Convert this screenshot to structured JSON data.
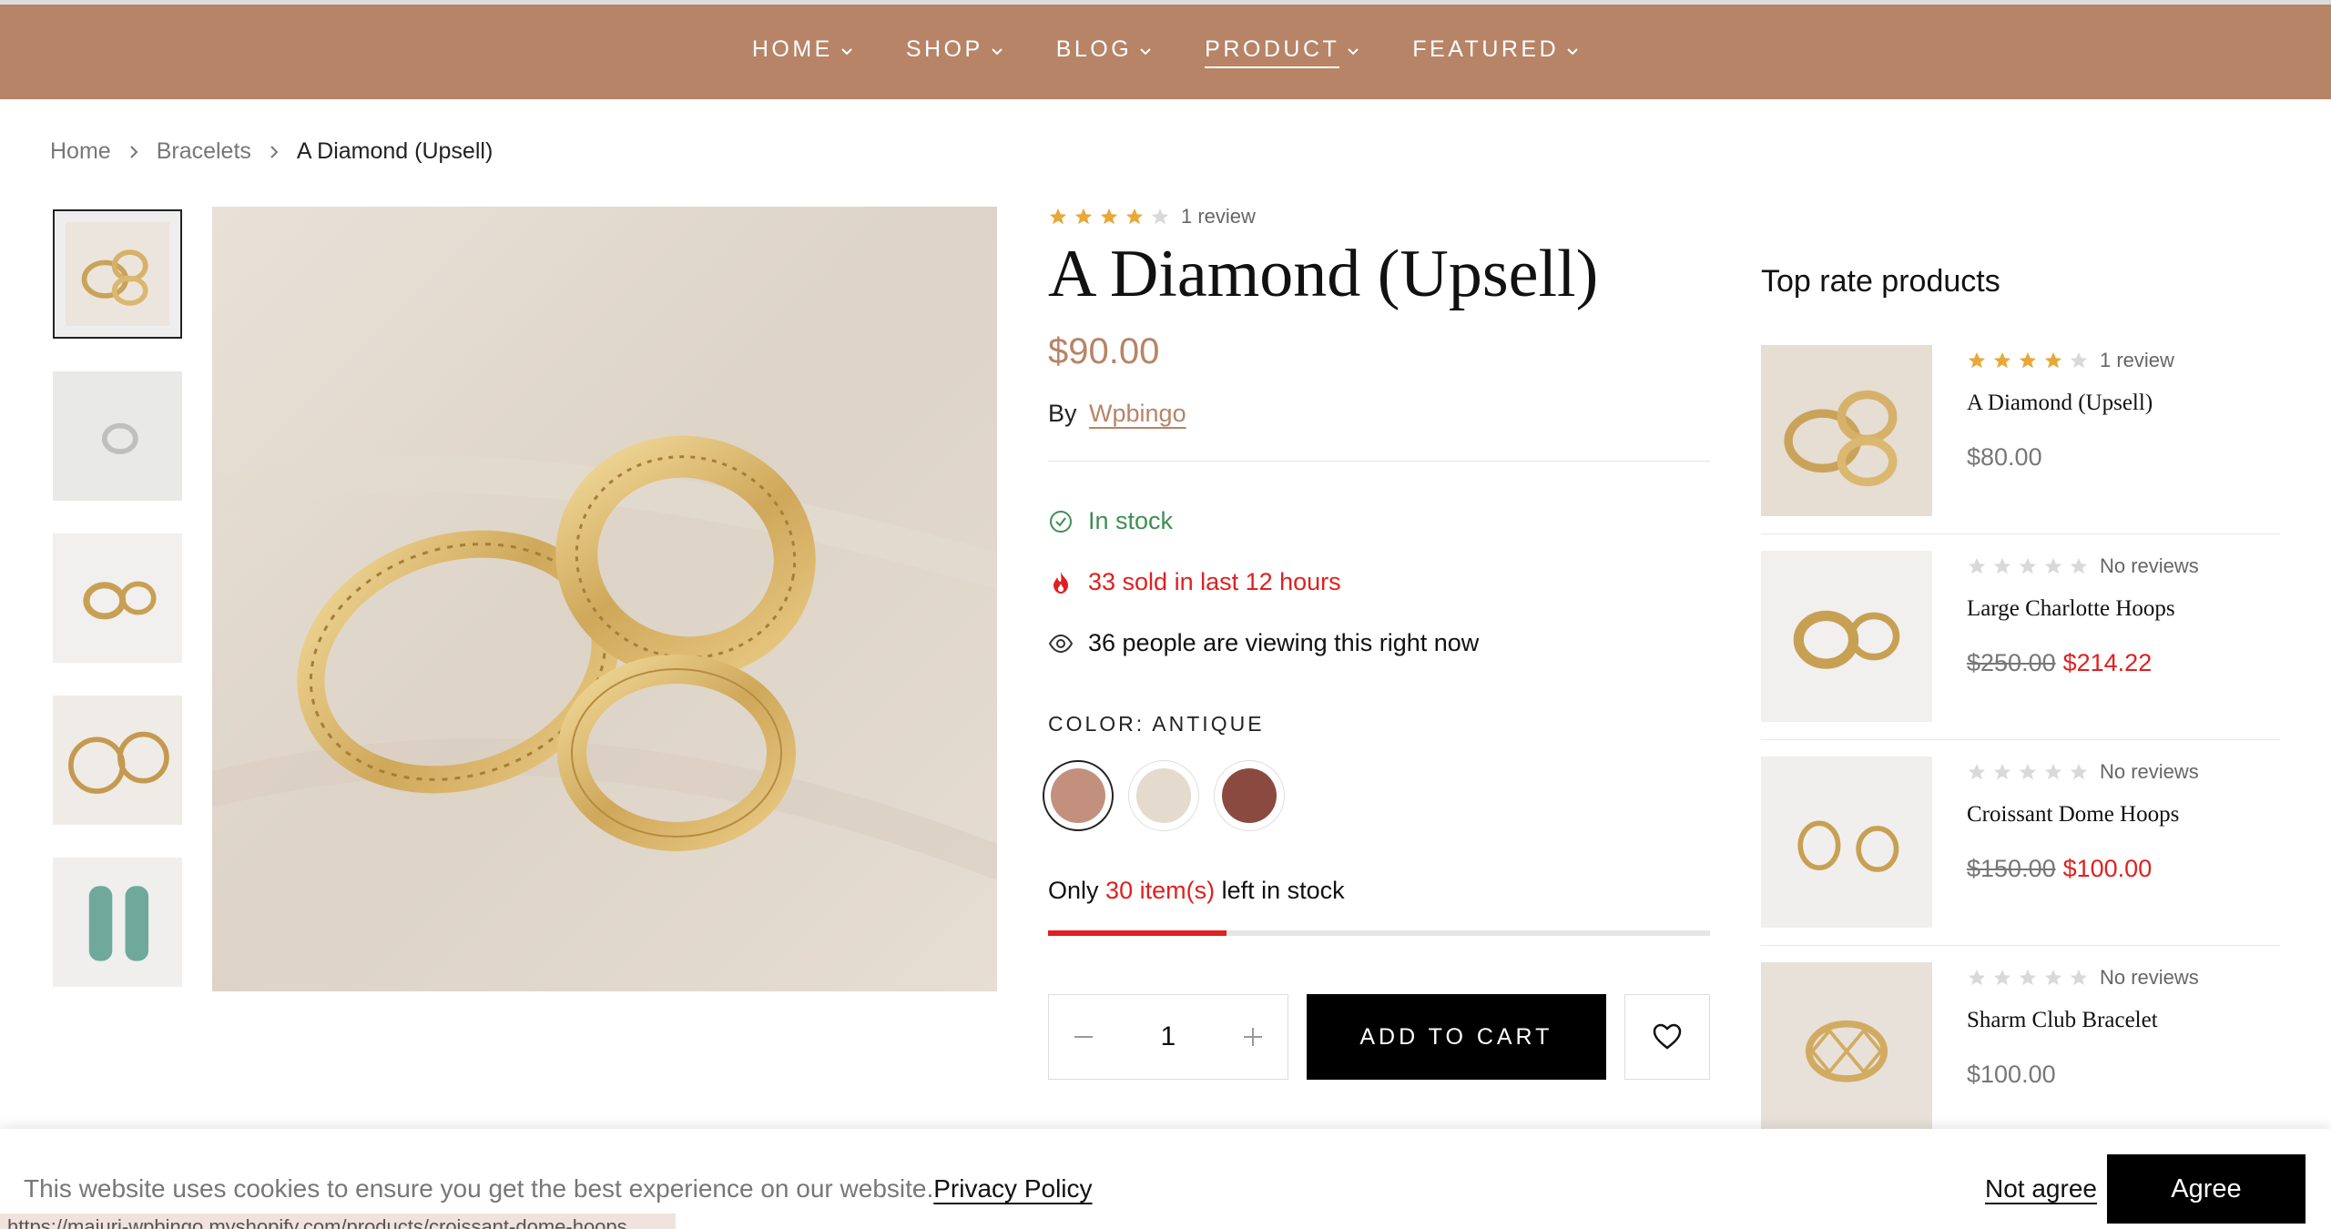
{
  "nav": {
    "items": [
      {
        "label": "HOME"
      },
      {
        "label": "SHOP"
      },
      {
        "label": "BLOG"
      },
      {
        "label": "PRODUCT"
      },
      {
        "label": "FEATURED"
      }
    ],
    "active_index": 3
  },
  "breadcrumb": {
    "items": [
      "Home",
      "Bracelets"
    ],
    "current": "A Diamond (Upsell)"
  },
  "product": {
    "rating": 4,
    "review_text": "1 review",
    "title": "A Diamond (Upsell)",
    "price": "$90.00",
    "by_label": "By",
    "vendor": "Wpbingo",
    "stock_status": "In stock",
    "sold_text": "33 sold in last 12 hours",
    "viewing_text": "36 people are viewing this right now",
    "color_label": "COLOR: ANTIQUE",
    "swatches": [
      {
        "name": "Antique",
        "color": "#c4907e",
        "selected": true
      },
      {
        "name": "Cream",
        "color": "#e5dace",
        "selected": false
      },
      {
        "name": "Brown",
        "color": "#8b4a40",
        "selected": false
      }
    ],
    "stock_left_prefix": "Only",
    "stock_left_count": "30 item(s)",
    "stock_left_suffix": "left in stock",
    "stock_fraction": 0.27,
    "quantity": "1",
    "add_to_cart": "ADD TO CART"
  },
  "sidebar": {
    "title": "Top rate products",
    "items": [
      {
        "rating": 4,
        "reviews": "1 review",
        "name": "A Diamond (Upsell)",
        "price": "$80.00",
        "old_price": "",
        "sale_price": ""
      },
      {
        "rating": 0,
        "reviews": "No reviews",
        "name": "Large Charlotte Hoops",
        "price": "",
        "old_price": "$250.00",
        "sale_price": "$214.22"
      },
      {
        "rating": 0,
        "reviews": "No reviews",
        "name": "Croissant Dome Hoops",
        "price": "",
        "old_price": "$150.00",
        "sale_price": "$100.00"
      },
      {
        "rating": 0,
        "reviews": "No reviews",
        "name": "Sharm Club Bracelet",
        "price": "$100.00",
        "old_price": "",
        "sale_price": ""
      }
    ]
  },
  "cookie": {
    "text": "This website uses cookies to ensure you get the best experience on our website.",
    "policy_link": "Privacy Policy",
    "not_agree": "Not agree",
    "agree": "Agree"
  },
  "status_url": "https://maiuri-wpbingo.myshopify.com/products/croissant-dome-hoops",
  "colors": {
    "accent": "#b78467",
    "sale_red": "#e02020",
    "stock_green": "#3e8e53",
    "star": "#e8a838"
  }
}
